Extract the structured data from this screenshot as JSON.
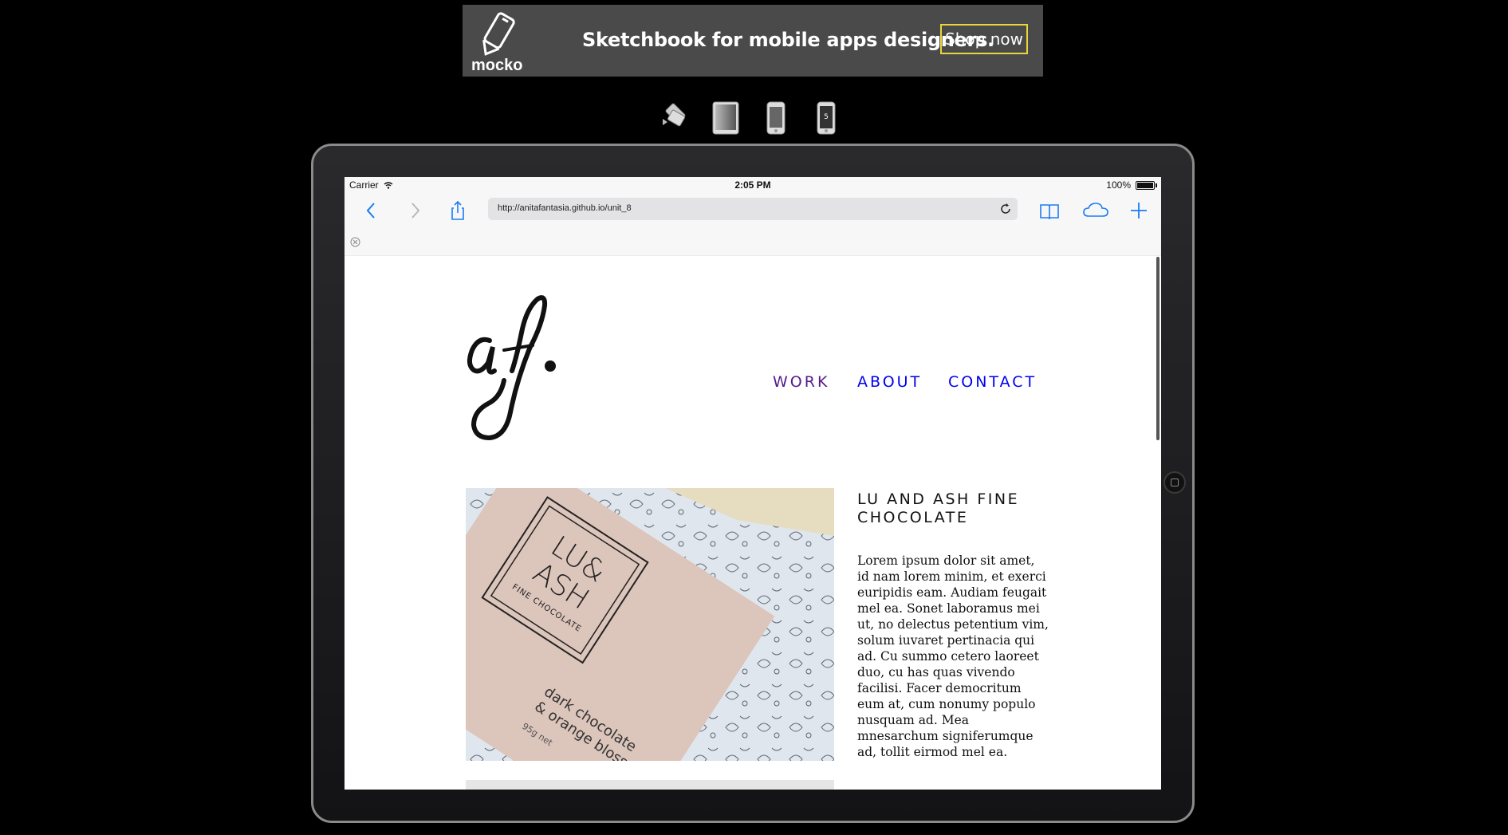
{
  "ad": {
    "brand": "mocko",
    "headline": "Sketchbook for mobile apps designers.",
    "cta": "Shop now"
  },
  "device_picker": [
    "rotate-icon",
    "ipad-icon",
    "iphone-icon",
    "iphone5-icon"
  ],
  "device_picker_badge": "5",
  "status_bar": {
    "carrier": "Carrier",
    "time": "2:05 PM",
    "battery": "100%"
  },
  "browser": {
    "url": "http://anitafantasia.github.io/unit_8"
  },
  "site": {
    "logo_text": "af.",
    "nav": [
      "WORK",
      "ABOUT",
      "CONTACT"
    ],
    "project": {
      "title": "LU AND ASH FINE CHOCOLATE",
      "body": "Lorem ipsum dolor sit amet, id nam lorem minim, et exerci euripidis eam. Audiam feugait mel ea. Sonet laboramus mei ut, no delectus petentium vim, solum iuvaret pertinacia qui ad. Cu summo cetero laoreet duo, cu has quas vivendo facilisi. Facer democritum eum at, cum nonumy populo nusquam ad. Mea mnesarchum signiferumque ad, tollit eirmod mel ea.",
      "image": {
        "brand_line1": "LU&",
        "brand_line2": "ASH",
        "brand_line3": "FINE CHOCOLATE",
        "flavor_line1": "dark chocolate",
        "flavor_line2": "& orange blossom",
        "weight": "95g net"
      }
    }
  },
  "colors": {
    "ad_bg": "#4a4a4a",
    "ad_cta_border": "#e8d63a",
    "ios_blue": "#1a7cf5",
    "nav_visited": "#551a8b",
    "nav_link": "#0000ee"
  }
}
